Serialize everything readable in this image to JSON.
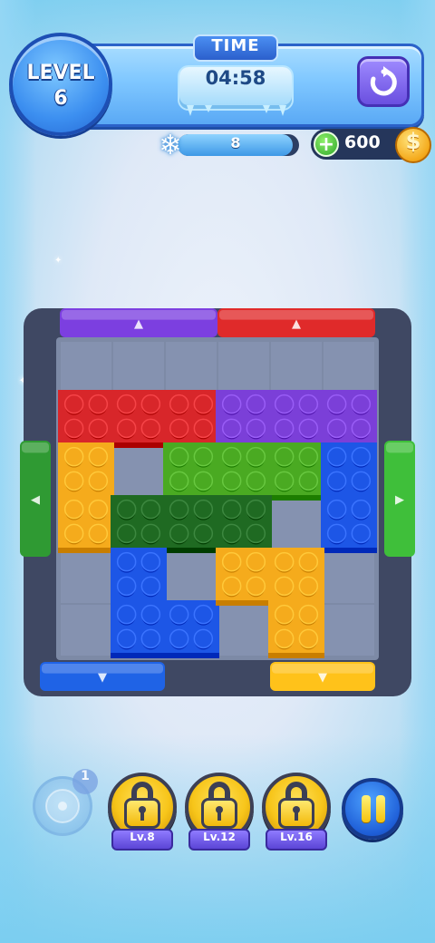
{
  "header": {
    "level_label": "LEVEL",
    "level_number": "6",
    "time_label": "TIME",
    "timer": "04:58",
    "restart_icon": "restart-icon"
  },
  "freeze": {
    "icon": "snowflake-icon",
    "count": "8",
    "fill": 0.95
  },
  "coins": {
    "plus_icon": "+",
    "value": "600",
    "coin_symbol": "$"
  },
  "board": {
    "columns": 6,
    "rows": 6,
    "gates": [
      {
        "side": "top",
        "color": "#7c3fe0",
        "from": 0,
        "to": 3,
        "arrow": "▲"
      },
      {
        "side": "top",
        "color": "#e02a2a",
        "from": 3,
        "to": 6,
        "arrow": "▲"
      },
      {
        "side": "left",
        "color": "#2f9a33",
        "from": 2,
        "to": 4,
        "arrow": "◀"
      },
      {
        "side": "right",
        "color": "#3fbf3a",
        "from": 2,
        "to": 4,
        "arrow": "▶"
      },
      {
        "side": "bottom",
        "color": "#1f63e6",
        "from": 0,
        "to": 2,
        "arrow": "▼"
      },
      {
        "side": "bottom",
        "color": "#ffc21a",
        "from": 4,
        "to": 6,
        "arrow": "▼"
      }
    ],
    "blocks": [
      {
        "name": "red",
        "color": "#d8262a",
        "cells": [
          [
            0,
            1
          ],
          [
            1,
            1
          ],
          [
            2,
            1
          ]
        ]
      },
      {
        "name": "purple",
        "color": "#7b3fd8",
        "cells": [
          [
            3,
            1
          ],
          [
            4,
            1
          ],
          [
            5,
            1
          ]
        ]
      },
      {
        "name": "orange-vertical",
        "color": "#f5ab1c",
        "cells": [
          [
            0,
            2
          ],
          [
            0,
            3
          ]
        ]
      },
      {
        "name": "light-green",
        "color": "#4aaa22",
        "cells": [
          [
            2,
            2
          ],
          [
            3,
            2
          ],
          [
            4,
            2
          ]
        ]
      },
      {
        "name": "blue-vertical",
        "color": "#1d56e6",
        "cells": [
          [
            5,
            2
          ],
          [
            5,
            3
          ]
        ]
      },
      {
        "name": "dark-green",
        "color": "#1f6a22",
        "cells": [
          [
            1,
            3
          ],
          [
            2,
            3
          ],
          [
            3,
            3
          ]
        ]
      },
      {
        "name": "blue-l",
        "color": "#1d56e6",
        "cells": [
          [
            1,
            4
          ],
          [
            1,
            5
          ],
          [
            2,
            5
          ]
        ]
      },
      {
        "name": "orange-l",
        "color": "#f5ab1c",
        "cells": [
          [
            3,
            4
          ],
          [
            4,
            4
          ],
          [
            4,
            5
          ]
        ]
      }
    ]
  },
  "bottom_bar": {
    "fan_booster_icon": "fan-icon",
    "fan_booster_count": "1",
    "locked_boosters": [
      {
        "label": "Lv.8",
        "icon": "lock-icon"
      },
      {
        "label": "Lv.12",
        "icon": "lock-icon"
      },
      {
        "label": "Lv.16",
        "icon": "lock-icon"
      }
    ],
    "pause_icon": "pause-icon"
  }
}
